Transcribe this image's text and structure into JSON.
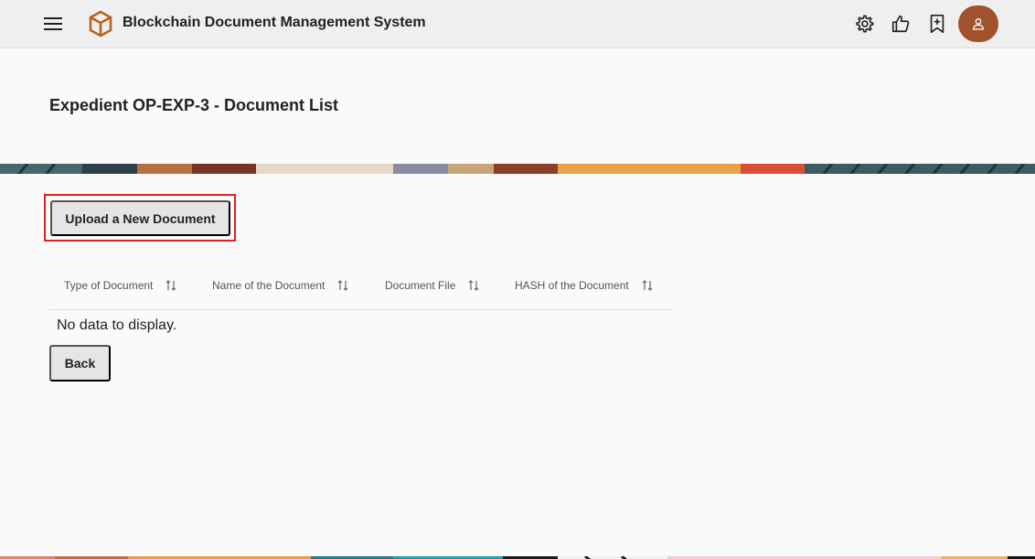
{
  "header": {
    "app_title": "Blockchain Document Management System",
    "icons": [
      "menu-icon",
      "cube-logo-icon",
      "settings-icon",
      "thumbs-up-icon",
      "bookmark-add-icon",
      "user-icon"
    ]
  },
  "page": {
    "title": "Expedient OP-EXP-3 - Document List"
  },
  "actions": {
    "upload_label": "Upload a New Document",
    "back_label": "Back"
  },
  "table": {
    "columns": [
      "Type of Document",
      "Name of the Document",
      "Document File",
      "HASH of the Document"
    ],
    "empty_message": "No data to display.",
    "rows": []
  },
  "colors": {
    "header_bg": "#efefef",
    "page_bg": "#fafafa",
    "logo": "#b5651d",
    "avatar": "#a0522d",
    "highlight_outline": "#e02020",
    "button_bg": "#e5e5e5"
  }
}
